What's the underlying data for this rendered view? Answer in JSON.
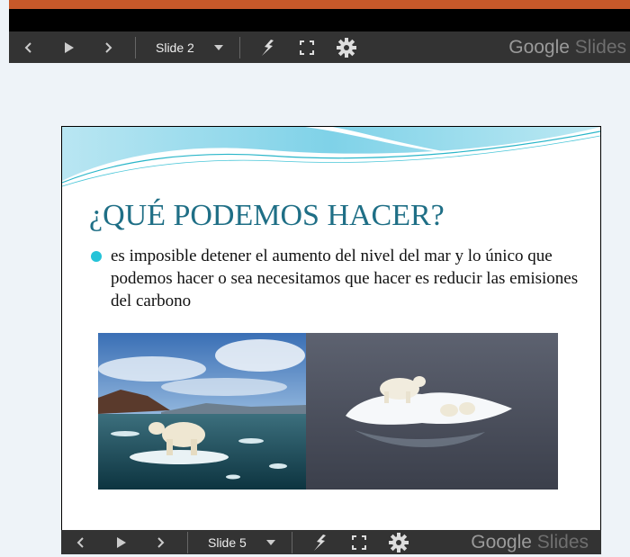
{
  "top_player": {
    "slide_label": "Slide 2",
    "brand_google": "Google",
    "brand_slides": "Slides"
  },
  "slide": {
    "title": "¿QUÉ PODEMOS HACER?",
    "bullet": "es imposible detener el aumento del nivel del mar y lo único que podemos hacer o sea necesitamos que hacer es reducir las emisiones del carbono"
  },
  "bottom_player": {
    "slide_label": "Slide 5",
    "brand_google": "Google",
    "brand_slides": "Slides"
  },
  "colors": {
    "accent_orange": "#c8592a",
    "title_teal": "#1f6f86",
    "bullet_cyan": "#25c3d8",
    "toolbar": "#333333"
  },
  "icons": [
    "chevron-left-icon",
    "play-icon",
    "chevron-right-icon",
    "caret-down-icon",
    "laser-pointer-icon",
    "fullscreen-icon",
    "gear-icon"
  ]
}
